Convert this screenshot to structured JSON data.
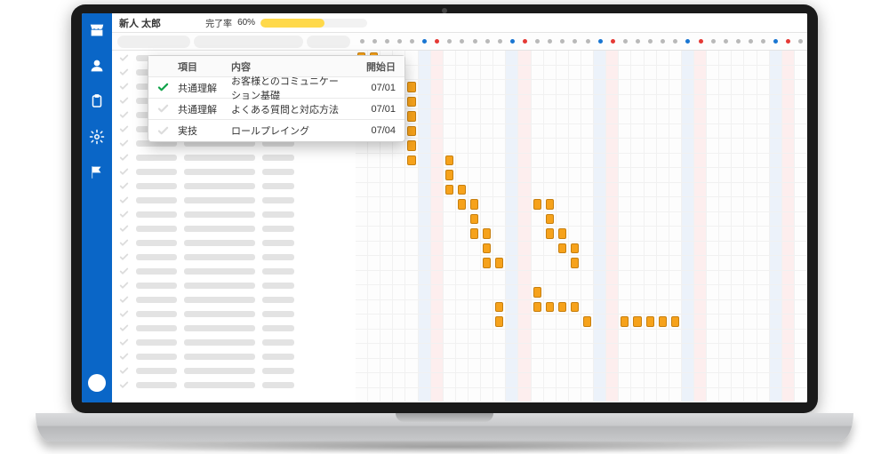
{
  "header": {
    "user_name": "新人 太郎",
    "progress_label": "完了率",
    "progress_value_label": "60%",
    "progress_pct": 60
  },
  "timeline": {
    "num_days": 36,
    "weekend_sat_cols": [
      5,
      12,
      19,
      26,
      33
    ],
    "weekend_sun_cols": [
      6,
      13,
      20,
      27,
      34
    ],
    "header_markers": [
      "grey",
      "grey",
      "grey",
      "grey",
      "grey",
      "blue",
      "red",
      "grey",
      "grey",
      "grey",
      "grey",
      "grey",
      "blue",
      "red",
      "grey",
      "grey",
      "grey",
      "grey",
      "grey",
      "blue",
      "red",
      "grey",
      "grey",
      "grey",
      "grey",
      "grey",
      "blue",
      "red",
      "grey",
      "grey",
      "grey",
      "grey",
      "grey",
      "blue",
      "red",
      "grey"
    ],
    "num_rows": 24
  },
  "gantt_bars": [
    {
      "row": 0,
      "col": 0,
      "span": 1
    },
    {
      "row": 0,
      "col": 1,
      "span": 1
    },
    {
      "row": 1,
      "col": 0,
      "span": 1
    },
    {
      "row": 1,
      "col": 1,
      "span": 1
    },
    {
      "row": 1,
      "col": 2,
      "span": 1
    },
    {
      "row": 1,
      "col": 3,
      "span": 1
    },
    {
      "row": 2,
      "col": 3,
      "span": 1
    },
    {
      "row": 2,
      "col": 4,
      "span": 1
    },
    {
      "row": 3,
      "col": 3,
      "span": 1
    },
    {
      "row": 3,
      "col": 4,
      "span": 1
    },
    {
      "row": 4,
      "col": 3,
      "span": 1
    },
    {
      "row": 4,
      "col": 4,
      "span": 1
    },
    {
      "row": 5,
      "col": 4,
      "span": 1
    },
    {
      "row": 6,
      "col": 4,
      "span": 1
    },
    {
      "row": 7,
      "col": 4,
      "span": 1
    },
    {
      "row": 7,
      "col": 7,
      "span": 1
    },
    {
      "row": 8,
      "col": 7,
      "span": 1
    },
    {
      "row": 9,
      "col": 7,
      "span": 1
    },
    {
      "row": 9,
      "col": 8,
      "span": 1
    },
    {
      "row": 10,
      "col": 8,
      "span": 1
    },
    {
      "row": 10,
      "col": 9,
      "span": 1
    },
    {
      "row": 10,
      "col": 14,
      "span": 1
    },
    {
      "row": 10,
      "col": 15,
      "span": 1
    },
    {
      "row": 11,
      "col": 9,
      "span": 1
    },
    {
      "row": 11,
      "col": 15,
      "span": 1
    },
    {
      "row": 12,
      "col": 9,
      "span": 1
    },
    {
      "row": 12,
      "col": 10,
      "span": 1
    },
    {
      "row": 12,
      "col": 15,
      "span": 1
    },
    {
      "row": 12,
      "col": 16,
      "span": 1
    },
    {
      "row": 13,
      "col": 10,
      "span": 1
    },
    {
      "row": 13,
      "col": 16,
      "span": 1
    },
    {
      "row": 13,
      "col": 17,
      "span": 1
    },
    {
      "row": 14,
      "col": 10,
      "span": 1
    },
    {
      "row": 14,
      "col": 11,
      "span": 1
    },
    {
      "row": 14,
      "col": 17,
      "span": 1
    },
    {
      "row": 16,
      "col": 14,
      "span": 1
    },
    {
      "row": 17,
      "col": 11,
      "span": 1
    },
    {
      "row": 17,
      "col": 14,
      "span": 1
    },
    {
      "row": 17,
      "col": 15,
      "span": 1
    },
    {
      "row": 17,
      "col": 16,
      "span": 1
    },
    {
      "row": 17,
      "col": 17,
      "span": 1
    },
    {
      "row": 18,
      "col": 11,
      "span": 1
    },
    {
      "row": 18,
      "col": 18,
      "span": 1
    },
    {
      "row": 18,
      "col": 21,
      "span": 1
    },
    {
      "row": 18,
      "col": 22,
      "span": 1
    },
    {
      "row": 18,
      "col": 23,
      "span": 1
    },
    {
      "row": 18,
      "col": 24,
      "span": 1
    },
    {
      "row": 18,
      "col": 25,
      "span": 1
    }
  ],
  "card": {
    "headers": {
      "c1": "項目",
      "c2": "内容",
      "c3": "開始日"
    },
    "rows": [
      {
        "done": true,
        "c1": "共通理解",
        "c2": "お客様とのコミュニケーション基礎",
        "c3": "07/01"
      },
      {
        "done": false,
        "c1": "共通理解",
        "c2": "よくある質問と対応方法",
        "c3": "07/01"
      },
      {
        "done": false,
        "c1": "実技",
        "c2": "ロールプレイング",
        "c3": "07/04"
      }
    ]
  },
  "nav": {
    "icons": [
      "store-icon",
      "user-icon",
      "clipboard-icon",
      "gear-icon",
      "flag-icon"
    ]
  }
}
